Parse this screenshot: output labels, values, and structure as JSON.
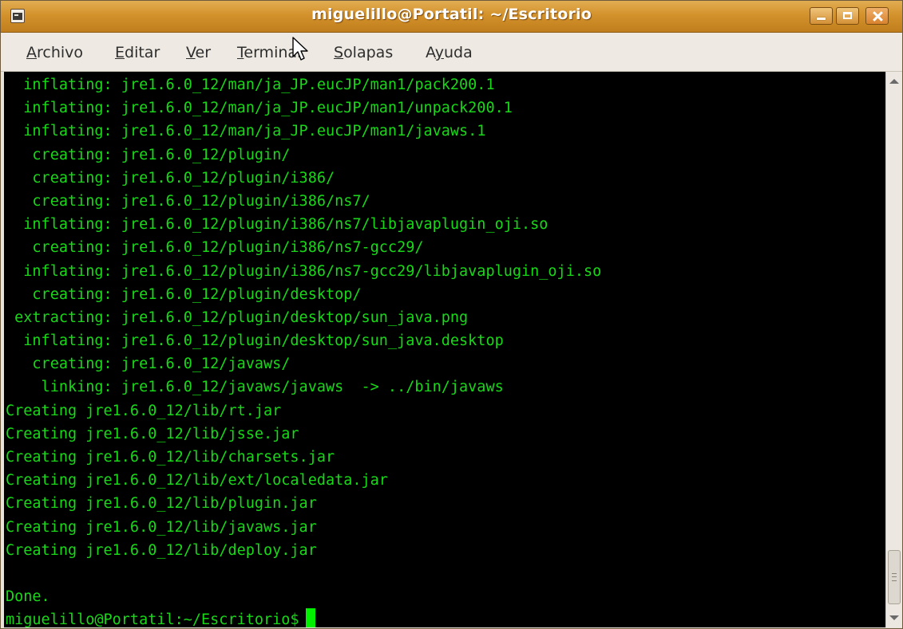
{
  "window": {
    "title": "miguelillo@Portatil: ~/Escritorio",
    "icon": "terminal-icon",
    "controls": [
      "minimize",
      "maximize",
      "close"
    ]
  },
  "menu": [
    {
      "label": "Archivo",
      "mnemonic": "A"
    },
    {
      "label": "Editar",
      "mnemonic": "E"
    },
    {
      "label": "Ver",
      "mnemonic": "V"
    },
    {
      "label": "Terminal",
      "mnemonic": "T"
    },
    {
      "label": "Solapas",
      "mnemonic": "S"
    },
    {
      "label": "Ayuda",
      "mnemonic": "y"
    }
  ],
  "terminal": {
    "colors": {
      "background": "#000000",
      "foreground": "#18d818",
      "cursor": "#00f000"
    },
    "lines": [
      "  inflating: jre1.6.0_12/man/ja_JP.eucJP/man1/pack200.1",
      "  inflating: jre1.6.0_12/man/ja_JP.eucJP/man1/unpack200.1",
      "  inflating: jre1.6.0_12/man/ja_JP.eucJP/man1/javaws.1",
      "   creating: jre1.6.0_12/plugin/",
      "   creating: jre1.6.0_12/plugin/i386/",
      "   creating: jre1.6.0_12/plugin/i386/ns7/",
      "  inflating: jre1.6.0_12/plugin/i386/ns7/libjavaplugin_oji.so",
      "   creating: jre1.6.0_12/plugin/i386/ns7-gcc29/",
      "  inflating: jre1.6.0_12/plugin/i386/ns7-gcc29/libjavaplugin_oji.so",
      "   creating: jre1.6.0_12/plugin/desktop/",
      " extracting: jre1.6.0_12/plugin/desktop/sun_java.png",
      "  inflating: jre1.6.0_12/plugin/desktop/sun_java.desktop",
      "   creating: jre1.6.0_12/javaws/",
      "    linking: jre1.6.0_12/javaws/javaws  -> ../bin/javaws",
      "Creating jre1.6.0_12/lib/rt.jar",
      "Creating jre1.6.0_12/lib/jsse.jar",
      "Creating jre1.6.0_12/lib/charsets.jar",
      "Creating jre1.6.0_12/lib/ext/localedata.jar",
      "Creating jre1.6.0_12/lib/plugin.jar",
      "Creating jre1.6.0_12/lib/javaws.jar",
      "Creating jre1.6.0_12/lib/deploy.jar",
      "",
      "Done."
    ],
    "prompt": "miguelillo@Portatil:~/Escritorio$"
  }
}
